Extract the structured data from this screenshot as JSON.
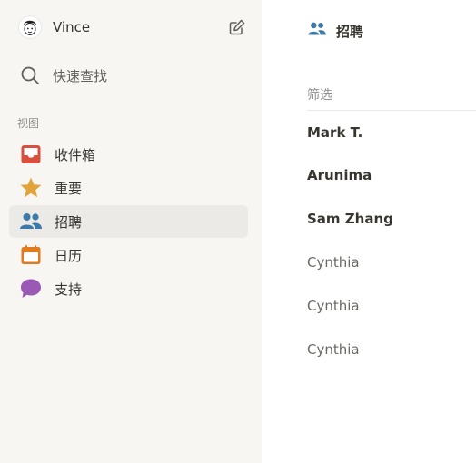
{
  "sidebar": {
    "user": {
      "name": "Vince"
    },
    "search_label": "快速查找",
    "section_label": "视图",
    "items": [
      {
        "label": "收件箱",
        "icon": "inbox-icon",
        "color": "#d94f3d"
      },
      {
        "label": "重要",
        "icon": "star-icon",
        "color": "#e0a43a"
      },
      {
        "label": "招聘",
        "icon": "people-icon",
        "color": "#3d7aa8",
        "active": true
      },
      {
        "label": "日历",
        "icon": "calendar-icon",
        "color": "#e07b1f"
      },
      {
        "label": "支持",
        "icon": "chat-bubble-icon",
        "color": "#9b59b6"
      }
    ]
  },
  "main": {
    "title": "招聘",
    "filter_label": "筛选",
    "list": [
      {
        "name": "Mark T.",
        "unread": true
      },
      {
        "name": "Arunima",
        "unread": true
      },
      {
        "name": "Sam Zhang",
        "unread": true
      },
      {
        "name": "Cynthia",
        "unread": false
      },
      {
        "name": "Cynthia",
        "unread": false
      },
      {
        "name": "Cynthia",
        "unread": false
      }
    ]
  },
  "colors": {
    "sidebar_bg": "#f7f6f3",
    "active_bg": "#ebeae7",
    "text": "#37352f",
    "muted": "#8f8e8a"
  }
}
